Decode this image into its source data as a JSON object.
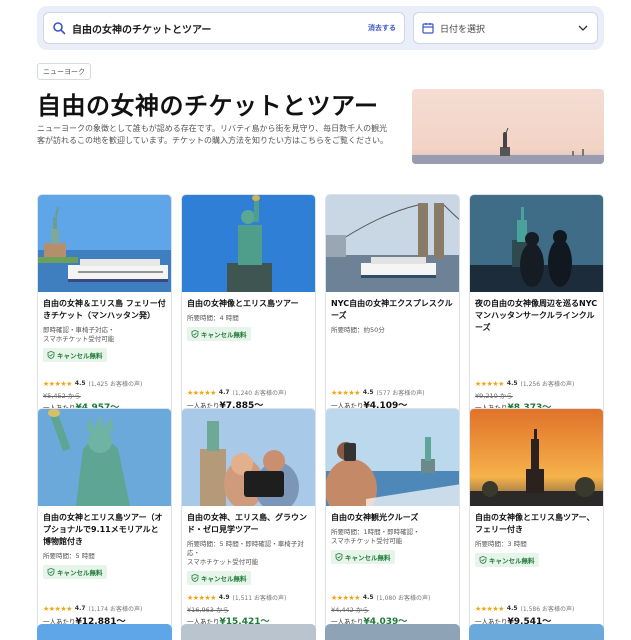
{
  "search": {
    "query": "自由の女神のチケットとツアー",
    "clear_label": "消去する",
    "date_placeholder": "日付を選択"
  },
  "breadcrumb": "ニューヨーク",
  "page": {
    "title": "自由の女神のチケットとツアー",
    "description": "ニューヨークの象徴として誰もが認める存在です。リバティ島から街を見守り、毎日数千人の観光客が訪れるこの地を歓迎しています。チケットの購入方法を知りたい方はこちらをご覧ください。"
  },
  "colors": {
    "accent": "#3b55c9",
    "price_green": "#1e7a38",
    "star": "#f2a611"
  },
  "cards": [
    {
      "title": "自由の女神＆エリス島 フェリー付きチケット（マンハッタン発）",
      "meta": [
        "即時確認・車椅子対応・",
        "スマホチケット受付可能"
      ],
      "badge": "キャンセル無料",
      "stars": "★★★★★",
      "rating": "4.5",
      "reviews": "(1,425 お客様の声)",
      "old_price": "¥5,452 から",
      "price_prefix": "一人あたり",
      "price": "¥4,957〜",
      "discount": true
    },
    {
      "title": "自由の女神像とエリス島ツアー",
      "meta": [
        "所要時間：4 時間"
      ],
      "badge": "キャンセル無料",
      "stars": "★★★★★",
      "rating": "4.7",
      "reviews": "(1,240 お客様の声)",
      "old_price": "",
      "price_prefix": "一人あたり",
      "price": "¥7,885〜",
      "discount": false
    },
    {
      "title": "NYC自由の女神エクスプレスクルーズ",
      "meta": [
        "所要時間：約50分"
      ],
      "badge": "",
      "stars": "★★★★★",
      "rating": "4.5",
      "reviews": "(577 お客様の声)",
      "old_price": "",
      "price_prefix": "一人あたり",
      "price": "¥4,109〜",
      "discount": false
    },
    {
      "title": "夜の自由の女神像周辺を巡るNYCマンハッタンサークルラインクルーズ",
      "meta": [],
      "badge": "",
      "stars": "★★★★★",
      "rating": "4.5",
      "reviews": "(1,256 お客様の声)",
      "old_price": "¥9,210 から",
      "price_prefix": "一人あたり",
      "price": "¥8,373〜",
      "discount": true
    },
    {
      "title": "自由の女神とエリス島ツアー（オプショナルで9.11メモリアルと博物館付き",
      "meta": [
        "所要時間：5 時間"
      ],
      "badge": "キャンセル無料",
      "stars": "★★★★★",
      "rating": "4.7",
      "reviews": "(1,174 お客様の声)",
      "old_price": "",
      "price_prefix": "一人あたり",
      "price": "¥12,881〜",
      "discount": false
    },
    {
      "title": "自由の女神、エリス島、グラウンド・ゼロ見学ツアー",
      "meta": [
        "所要時間：5 時間・即時確認・車椅子対応・",
        "スマホチケット受付可能"
      ],
      "badge": "キャンセル無料",
      "stars": "★★★★★",
      "rating": "4.9",
      "reviews": "(1,511 お客様の声)",
      "old_price": "¥16,963 から",
      "price_prefix": "一人あたり",
      "price": "¥15,421〜",
      "discount": true
    },
    {
      "title": "自由の女神観光クルーズ",
      "meta": [
        "所要時間：1時間・即時確認・",
        "スマホチケット受付可能"
      ],
      "badge": "キャンセル無料",
      "stars": "★★★★★",
      "rating": "4.5",
      "reviews": "(1,080 お客様の声)",
      "old_price": "¥4,442 から",
      "price_prefix": "一人あたり",
      "price": "¥4,039〜",
      "discount": true
    },
    {
      "title": "自由の女神像とエリス島ツアー、フェリー付き",
      "meta": [
        "所要時間：3 時間"
      ],
      "badge": "キャンセル無料",
      "stars": "★★★★★",
      "rating": "4.5",
      "reviews": "(1,586 お客様の声)",
      "old_price": "",
      "price_prefix": "一人あたり",
      "price": "¥9,541〜",
      "discount": false
    }
  ]
}
